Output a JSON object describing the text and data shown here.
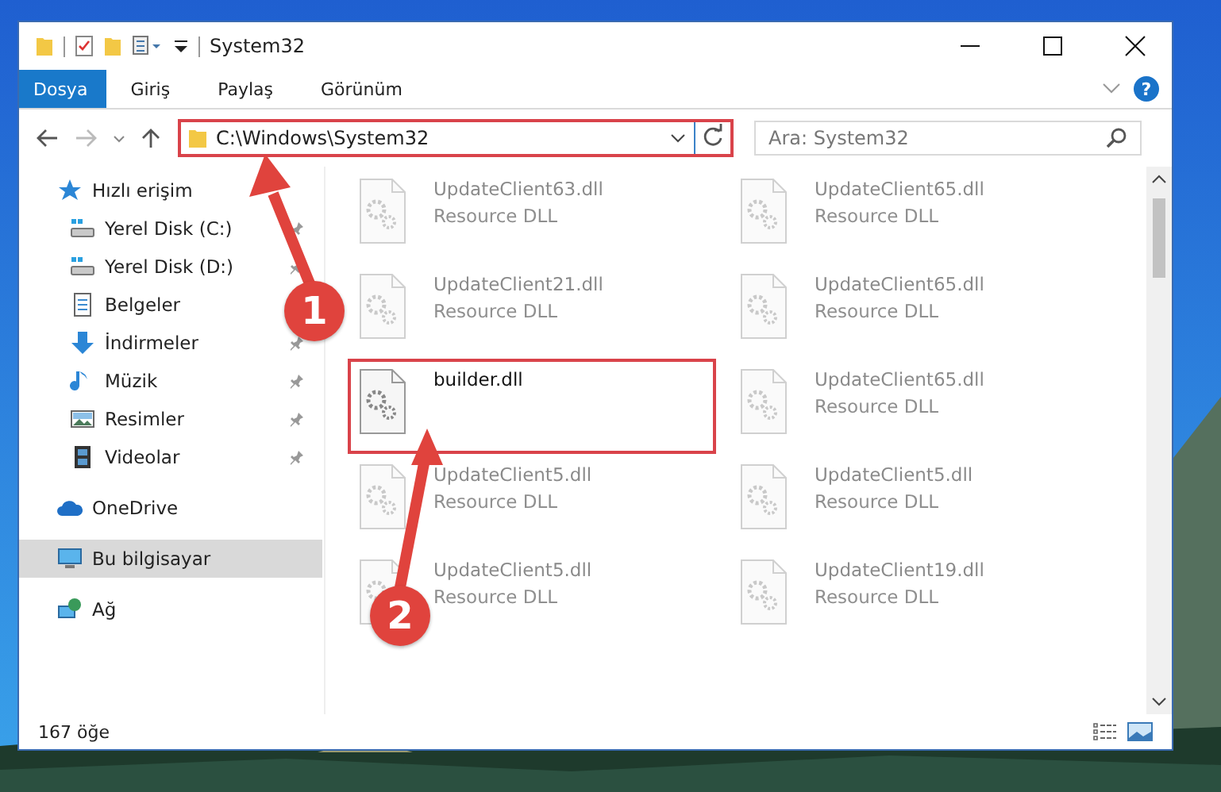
{
  "window": {
    "title": "System32"
  },
  "ribbon": {
    "tabs": [
      {
        "label": "Dosya",
        "selected": true
      },
      {
        "label": "Giriş",
        "selected": false
      },
      {
        "label": "Paylaş",
        "selected": false
      },
      {
        "label": "Görünüm",
        "selected": false
      }
    ],
    "help": "?"
  },
  "address_bar": {
    "value": "C:\\Windows\\System32",
    "highlighted": true
  },
  "search": {
    "placeholder": "Ara: System32"
  },
  "sidebar": {
    "items": [
      {
        "label": "Hızlı erişim",
        "kind": "star",
        "selected": false,
        "pinned": false,
        "children": [
          {
            "label": "Yerel Disk (C:)",
            "kind": "drive",
            "selected": false,
            "pinned": true
          },
          {
            "label": "Yerel Disk (D:)",
            "kind": "drive",
            "selected": false,
            "pinned": true
          },
          {
            "label": "Belgeler",
            "kind": "document",
            "selected": false
          },
          {
            "label": "İndirmeler",
            "kind": "download",
            "selected": false,
            "pinned": true
          },
          {
            "label": "Müzik",
            "kind": "music",
            "selected": false,
            "pinned": true
          },
          {
            "label": "Resimler",
            "selected": false,
            "pinned": true
          },
          {
            "label": "Videolar",
            "kind": "video",
            "selected": false,
            "pinned": true
          }
        ]
      },
      {
        "label": "OneDrive",
        "kind": "cloud",
        "selected": false,
        "pinned": false
      },
      {
        "label": "Bu bilgisayar",
        "kind": "computer",
        "selected": true,
        "pinned": false
      },
      {
        "label": "Ağ",
        "kind": "network",
        "selected": false,
        "pinned": false
      }
    ]
  },
  "files": [
    {
      "name": "UpdateClient63.dll",
      "type": "Resource DLL",
      "faded": true,
      "highlighted": false
    },
    {
      "name": "UpdateClient65.dll",
      "type": "Resource DLL",
      "faded": true,
      "highlighted": false
    },
    {
      "name": "UpdateClient21.dll",
      "type": "Resource DLL",
      "faded": true,
      "highlighted": false
    },
    {
      "name": "UpdateClient65.dll",
      "type": "Resource DLL",
      "faded": true,
      "highlighted": false
    },
    {
      "name": "builder.dll",
      "faded": false,
      "highlighted": true
    },
    {
      "name": "UpdateClient65.dll",
      "type": "Resource DLL",
      "faded": true,
      "highlighted": false
    },
    {
      "name": "UpdateClient5.dll",
      "type": "Resource DLL",
      "faded": true,
      "highlighted": false
    },
    {
      "name": "UpdateClient5.dll",
      "type": "Resource DLL",
      "faded": true,
      "highlighted": false
    },
    {
      "name": "UpdateClient5.dll",
      "type": "Resource DLL",
      "faded": true,
      "highlighted": false
    },
    {
      "name": "UpdateClient19.dll",
      "type": "Resource DLL",
      "faded": true,
      "highlighted": false
    }
  ],
  "status_bar": {
    "count": "167 öğe"
  },
  "annotations": [
    {
      "number": "1"
    },
    {
      "number": "2"
    }
  ]
}
